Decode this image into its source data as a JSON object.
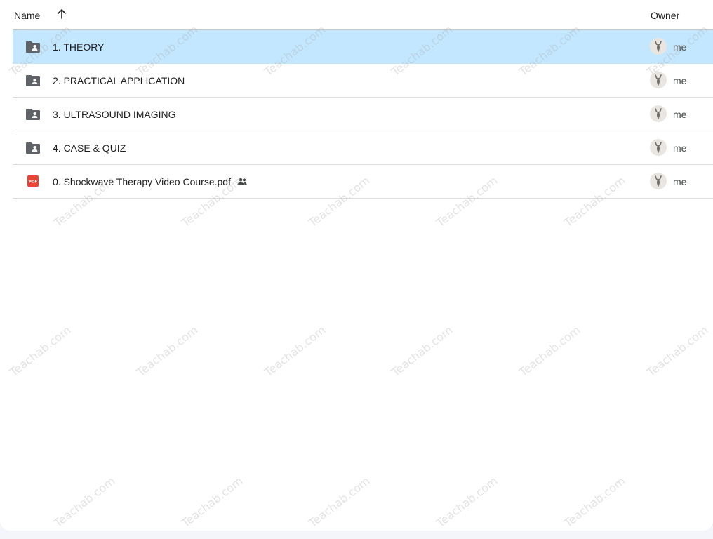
{
  "header": {
    "name_label": "Name",
    "sort_direction": "ascending",
    "owner_label": "Owner"
  },
  "files": [
    {
      "name": "1. THEORY",
      "type": "folder",
      "owner": "me",
      "selected": true,
      "shared": false
    },
    {
      "name": "2. PRACTICAL APPLICATION",
      "type": "folder",
      "owner": "me",
      "selected": false,
      "shared": false
    },
    {
      "name": "3. ULTRASOUND IMAGING",
      "type": "folder",
      "owner": "me",
      "selected": false,
      "shared": false
    },
    {
      "name": "4. CASE & QUIZ",
      "type": "folder",
      "owner": "me",
      "selected": false,
      "shared": false
    },
    {
      "name": "0. Shockwave Therapy Video Course.pdf",
      "type": "pdf",
      "pdf_badge": "PDF",
      "owner": "me",
      "selected": false,
      "shared": true
    }
  ],
  "watermark": "Teachab.com",
  "colors": {
    "selected_row": "#c2e7ff",
    "folder_icon": "#5f6368",
    "pdf_icon": "#ea4335"
  }
}
